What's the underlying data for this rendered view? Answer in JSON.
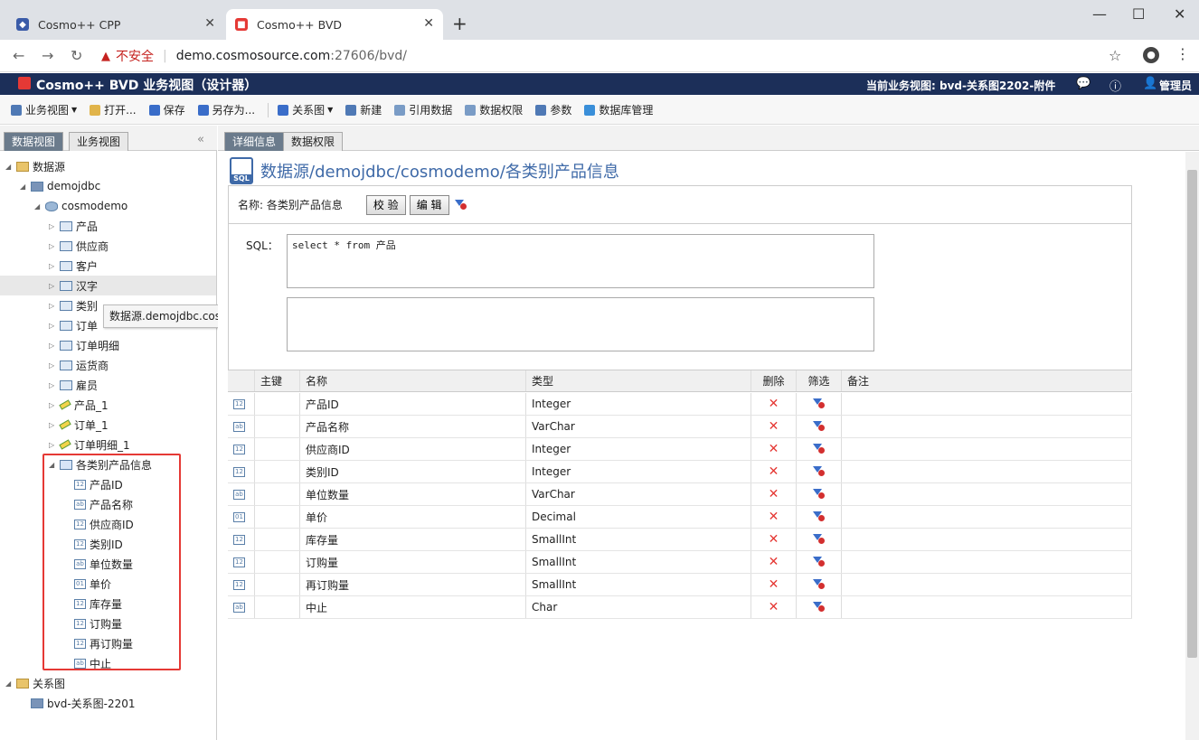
{
  "browser": {
    "tabs": [
      {
        "label": "Cosmo++ CPP"
      },
      {
        "label": "Cosmo++ BVD"
      }
    ],
    "insecure_label": "不安全",
    "url_host": "demo.cosmosource.com",
    "url_path": ":27606/bvd/"
  },
  "app": {
    "title": "Cosmo++ BVD 业务视图（设计器）",
    "current_view": "当前业务视图: bvd-关系图2202-附件",
    "admin": "管理员"
  },
  "toolbar": {
    "items": [
      "业务视图",
      "打开...",
      "保存",
      "另存为...",
      "关系图",
      "新建",
      "引用数据",
      "数据权限",
      "参数",
      "数据库管理"
    ]
  },
  "left": {
    "tabs": [
      "数据视图",
      "业务视图"
    ],
    "tree": {
      "root": "数据源",
      "server": "demojdbc",
      "db": "cosmodemo",
      "tables": [
        "产品",
        "供应商",
        "客户",
        "汉字",
        "类别",
        "订单",
        "订单明细",
        "运货商",
        "雇员"
      ],
      "derived": [
        "产品_1",
        "订单_1",
        "订单明细_1"
      ],
      "view": "各类别产品信息",
      "view_columns": [
        "产品ID",
        "产品名称",
        "供应商ID",
        "类别ID",
        "单位数量",
        "单价",
        "库存量",
        "订购量",
        "再订购量",
        "中止"
      ],
      "rel_root": "关系图",
      "rel_item": "bvd-关系图-2201"
    },
    "tooltip": "数据源.demojdbc.cosmodemo.汉字"
  },
  "right": {
    "tabs": [
      "详细信息",
      "数据权限"
    ],
    "path": "数据源/demojdbc/cosmodemo/各类别产品信息",
    "name_label": "名称: 各类别产品信息",
    "btn_validate": "校 验",
    "btn_edit": "编 辑",
    "sql_label": "SQL：",
    "sql_value": "select * from 产品",
    "grid": {
      "headers": [
        "主键",
        "名称",
        "类型",
        "删除",
        "筛选",
        "备注"
      ],
      "rows": [
        {
          "icon": "12",
          "name": "产品ID",
          "type": "Integer"
        },
        {
          "icon": "ab",
          "name": "产品名称",
          "type": "VarChar"
        },
        {
          "icon": "12",
          "name": "供应商ID",
          "type": "Integer"
        },
        {
          "icon": "12",
          "name": "类别ID",
          "type": "Integer"
        },
        {
          "icon": "ab",
          "name": "单位数量",
          "type": "VarChar"
        },
        {
          "icon": "01",
          "name": "单价",
          "type": "Decimal"
        },
        {
          "icon": "12",
          "name": "库存量",
          "type": "SmallInt"
        },
        {
          "icon": "12",
          "name": "订购量",
          "type": "SmallInt"
        },
        {
          "icon": "12",
          "name": "再订购量",
          "type": "SmallInt"
        },
        {
          "icon": "ab",
          "name": "中止",
          "type": "Char"
        }
      ]
    }
  }
}
